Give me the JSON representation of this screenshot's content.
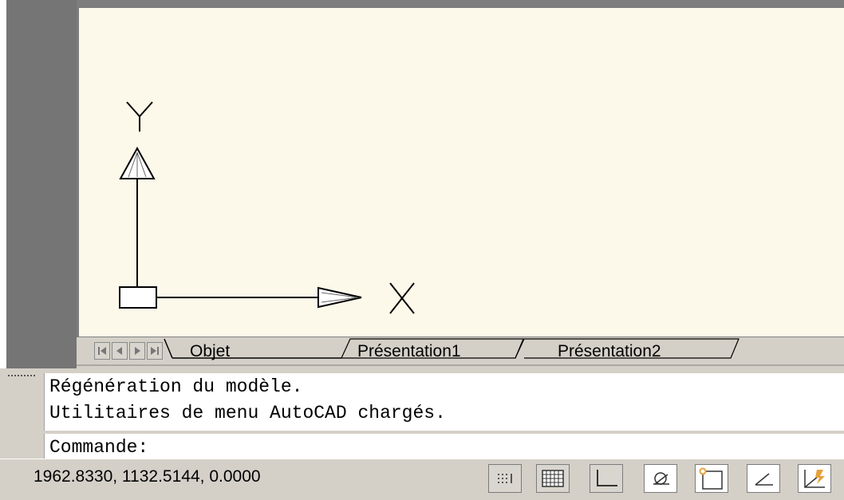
{
  "ucs": {
    "x_label": "X",
    "y_label": "Y"
  },
  "layout_tabs": [
    {
      "label": "Objet",
      "active": true
    },
    {
      "label": "Présentation1",
      "active": false
    },
    {
      "label": "Présentation2",
      "active": false
    }
  ],
  "tab_nav": [
    "first",
    "previous",
    "next",
    "last"
  ],
  "command_line": {
    "history": [
      "Régénération du modèle.",
      "Utilitaires de menu AutoCAD chargés."
    ],
    "prompt": "Commande:"
  },
  "status": {
    "coordinates": "1962.8330, 1132.5144, 0.0000",
    "toggles": [
      {
        "icon": "snap-icon",
        "on": false
      },
      {
        "icon": "grid-icon",
        "on": false
      },
      {
        "icon": "ortho-icon",
        "on": false
      },
      {
        "icon": "polar-icon",
        "on": true
      },
      {
        "icon": "osnap-icon",
        "on": true
      },
      {
        "icon": "otrack-icon",
        "on": true
      },
      {
        "icon": "ducs-icon",
        "on": true
      }
    ]
  },
  "colors": {
    "canvas": "#fcf8ea",
    "chrome": "#d4d0c8",
    "osnap_accent": "#e8a13a"
  }
}
